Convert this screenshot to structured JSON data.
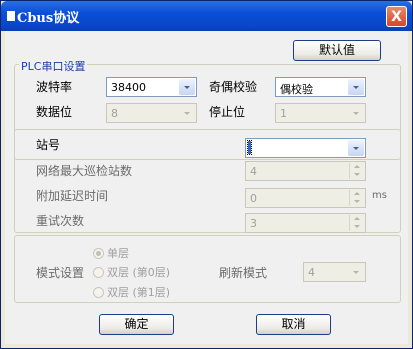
{
  "window": {
    "title": "Cbus协议",
    "close_label": "X"
  },
  "toolbar": {
    "default_label": "默认值"
  },
  "plc_group": {
    "title": "PLC串口设置",
    "baud_label": "波特率",
    "baud_value": "38400",
    "parity_label": "奇偶校验",
    "parity_value": "偶校验",
    "databits_label": "数据位",
    "databits_value": "8",
    "stopbits_label": "停止位",
    "stopbits_value": "1"
  },
  "station_group": {
    "station_label": "站号",
    "max_poll_label": "网络最大巡检站数",
    "max_poll_value": "4",
    "delay_label": "附加延迟时间",
    "delay_value": "0",
    "delay_unit": "ms",
    "retry_label": "重试次数",
    "retry_value": "3"
  },
  "mode_group": {
    "mode_label": "模式设置",
    "options": [
      "单层",
      "双层 (第0层)",
      "双层 (第1层)"
    ],
    "refresh_label": "刷新模式",
    "refresh_value": "4"
  },
  "footer": {
    "ok_label": "确定",
    "cancel_label": "取消"
  }
}
